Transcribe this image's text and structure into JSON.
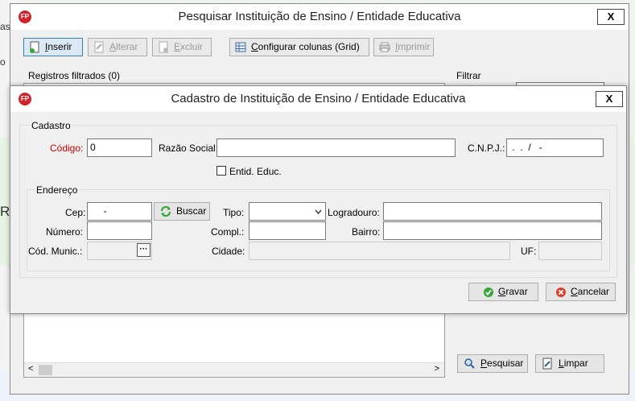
{
  "background": {
    "left_fragment_top": "as",
    "left_fragment_mid": "o",
    "left_fragment_R": "R"
  },
  "main_window": {
    "title": "Pesquisar Instituição de Ensino / Entidade Educativa",
    "logo": "FP",
    "close_label": "X",
    "toolbar": {
      "inserir_first": "I",
      "inserir_rest": "nserir",
      "alterar_first": "A",
      "alterar_rest": "lterar",
      "excluir_first": "E",
      "excluir_rest": "xcluir",
      "configurar_first": "C",
      "configurar_rest": "onfigurar colunas (Grid)",
      "imprimir_first": "I",
      "imprimir_rest": "mprimir"
    },
    "records_label": "Registros filtrados (0)",
    "filter_label": "Filtrar",
    "pesquisar_first": "P",
    "pesquisar_rest": "esquisar",
    "limpar_first": "L",
    "limpar_rest": "impar",
    "scroll_left": "<",
    "scroll_right": ">"
  },
  "dialog": {
    "title": "Cadastro de Instituição de Ensino / Entidade Educativa",
    "logo": "FP",
    "close_label": "X",
    "cadastro_group": "Cadastro",
    "codigo_label": "Código:",
    "codigo_value": "0",
    "razao_label": "Razão Social:",
    "razao_value": "",
    "cnpj_label": "C.N.P.J.:",
    "cnpj_value": " .  .  /   -",
    "entid_label": "Entid. Educ.",
    "endereco_group": "Endereço",
    "cep_label": "Cep:",
    "cep_value": "     -",
    "buscar_label": "Buscar",
    "tipo_label": "Tipo:",
    "tipo_value": "",
    "logradouro_label": "Logradouro:",
    "numero_label": "Número:",
    "compl_label": "Compl.:",
    "bairro_label": "Bairro:",
    "cod_munic_label": "Cód. Munic.:",
    "cod_munic_btn": "···",
    "cidade_label": "Cidade:",
    "uf_label": "UF:",
    "gravar_first": "G",
    "gravar_rest": "ravar",
    "cancelar_first": "C",
    "cancelar_rest": "ancelar"
  },
  "colors": {
    "logo_red": "#d2232a",
    "required_label": "#cc0000",
    "gravar_icon": "#3aa53a",
    "cancelar_icon": "#d9412b"
  }
}
